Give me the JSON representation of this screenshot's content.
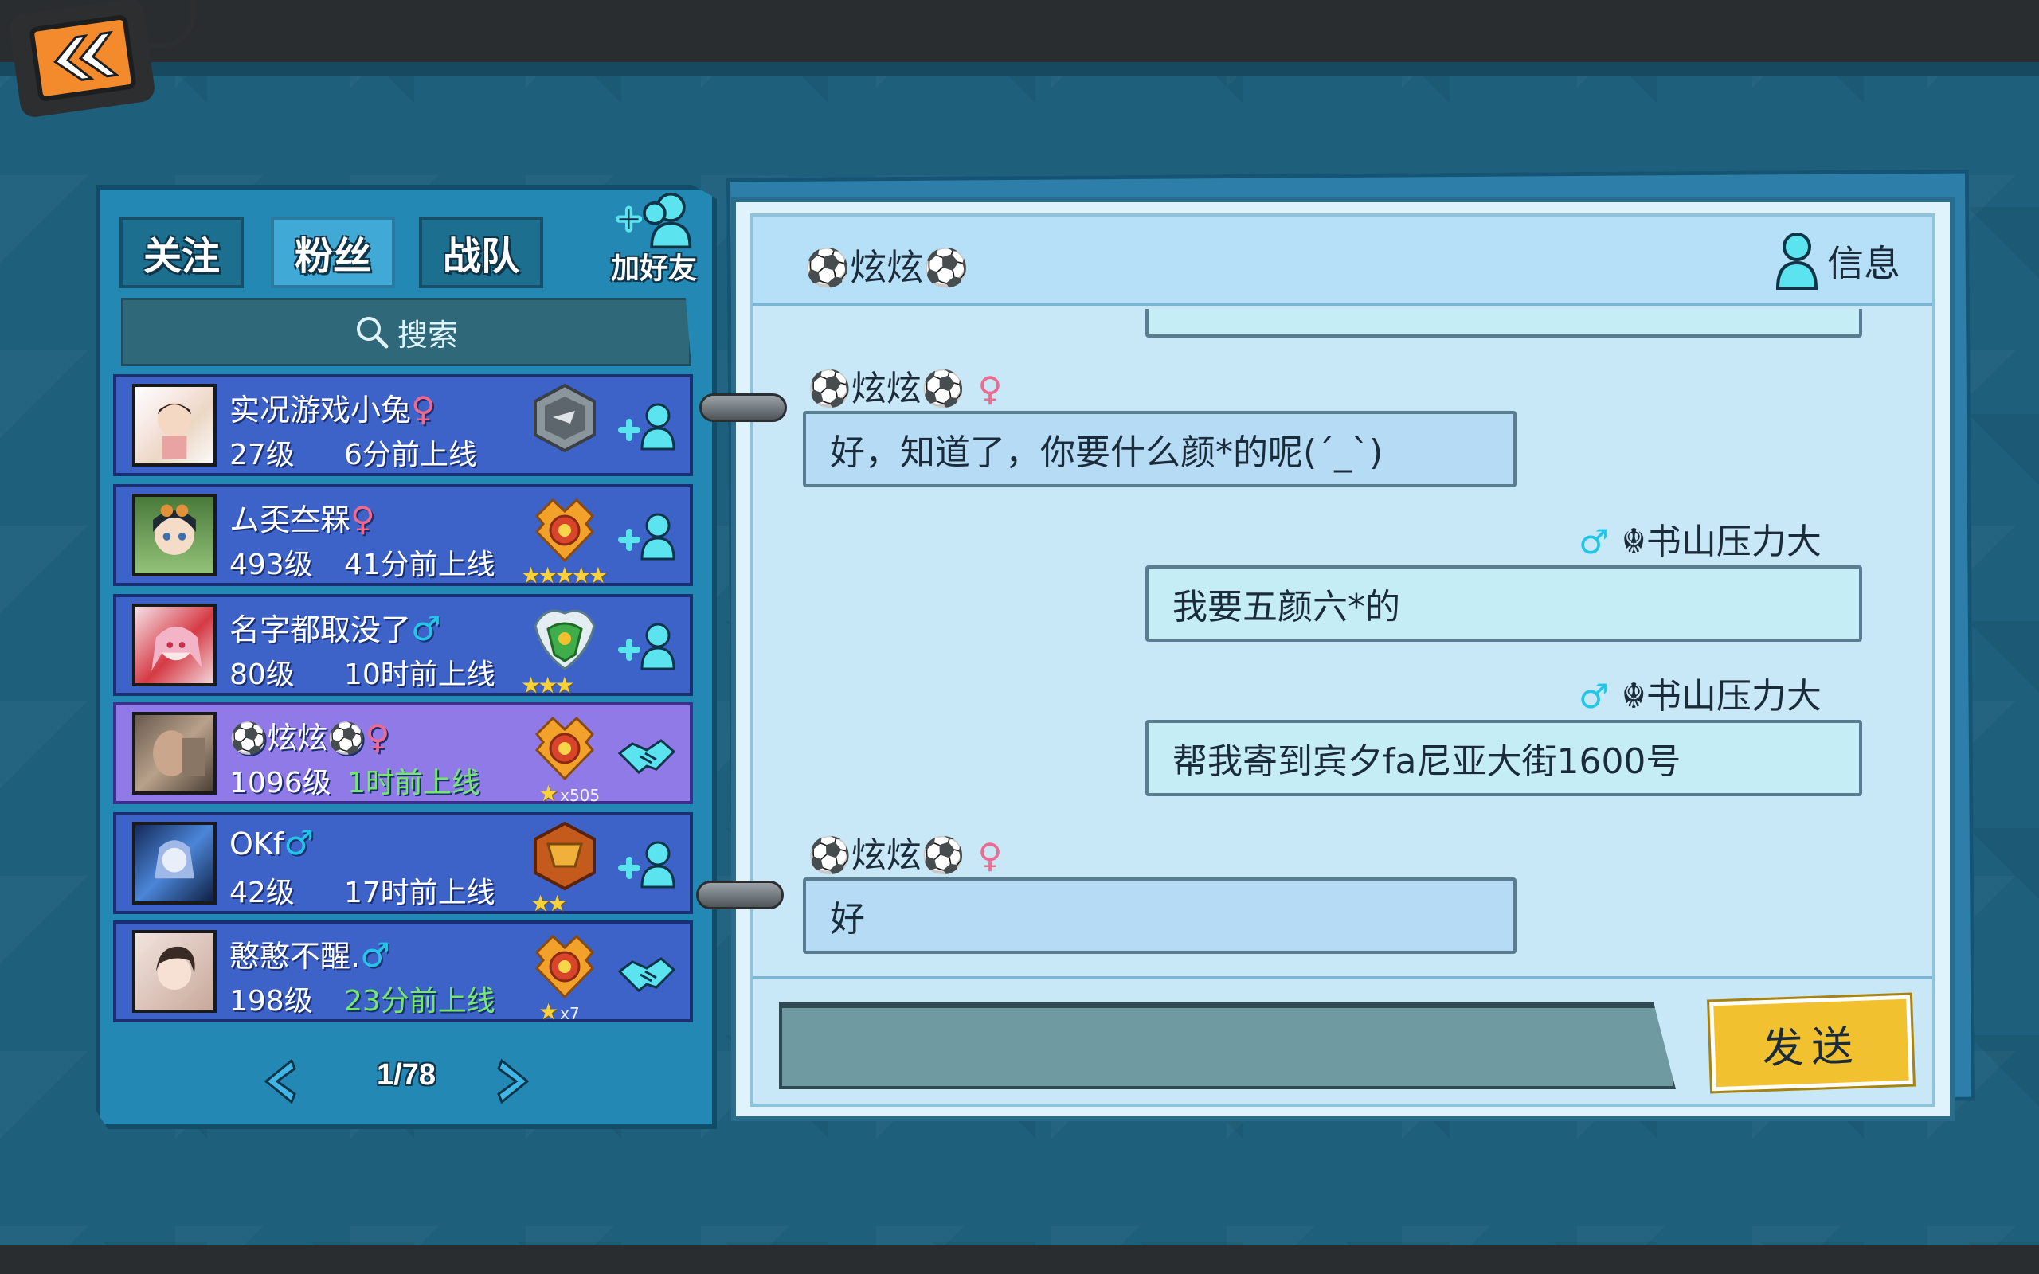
{
  "tabs": [
    {
      "label": "关注",
      "active": false
    },
    {
      "label": "粉丝",
      "active": true
    },
    {
      "label": "战队",
      "active": false
    }
  ],
  "add_friend_label": "加好友",
  "search_label": "搜索",
  "friends": [
    {
      "name": "实况游戏小兔",
      "gender": "♀",
      "level": "27级",
      "last_online": "6分前上线",
      "recent": false,
      "rank_stars": "",
      "rank_mult": "",
      "action": "add-friend"
    },
    {
      "name": "ム奀夳槑",
      "gender": "♀",
      "level": "493级",
      "last_online": "41分前上线",
      "recent": false,
      "rank_stars": "★★★★★",
      "rank_mult": "",
      "action": "add-friend"
    },
    {
      "name": "名字都取没了",
      "gender": "♂",
      "level": "80级",
      "last_online": "10时前上线",
      "recent": false,
      "rank_stars": "★★★",
      "rank_mult": "",
      "action": "add-friend"
    },
    {
      "name": "⚽炫炫⚽",
      "gender": "♀",
      "level": "1096级",
      "last_online": "1时前上线",
      "recent": true,
      "rank_stars": "★",
      "rank_mult": "x505",
      "action": "handshake"
    },
    {
      "name": "OKf",
      "gender": "♂",
      "level": "42级",
      "last_online": "17时前上线",
      "recent": false,
      "rank_stars": "★★",
      "rank_mult": "",
      "action": "add-friend"
    },
    {
      "name": "憨憨不醒.",
      "gender": "♂",
      "level": "198级",
      "last_online": "23分前上线",
      "recent": true,
      "rank_stars": "★",
      "rank_mult": "x7",
      "action": "handshake"
    }
  ],
  "pager": {
    "text": "1/78"
  },
  "chat": {
    "title": "⚽炫炫⚽",
    "info_label": "信息",
    "messages": [
      {
        "sender": "⚽炫炫⚽",
        "gender": "♀",
        "text": "好，知道了，你要什么颜*的呢(´_`)",
        "mine": false
      },
      {
        "sender": "☬书山压力大",
        "gender": "♂",
        "text": "我要五颜六*的",
        "mine": true
      },
      {
        "sender": "☬书山压力大",
        "gender": "♂",
        "text": "帮我寄到宾夕fa尼亚大街1600号",
        "mine": true
      },
      {
        "sender": "⚽炫炫⚽",
        "gender": "♀",
        "text": "好",
        "mine": false
      }
    ],
    "input_value": "",
    "send_label": "发送"
  },
  "colors": {
    "background": "#1e5f7c",
    "row": "#3d62c8",
    "row_highlight": "#8f7ae8",
    "send": "#f2c130",
    "female": "#f06a8f",
    "male": "#23c6e8",
    "recent": "#74e76c"
  },
  "icons": [
    "back-arrow-icon",
    "add-friend-icon",
    "search-icon",
    "rank-badge-icon",
    "handshake-icon",
    "prev-arrow-icon",
    "next-arrow-icon",
    "user-info-icon"
  ]
}
